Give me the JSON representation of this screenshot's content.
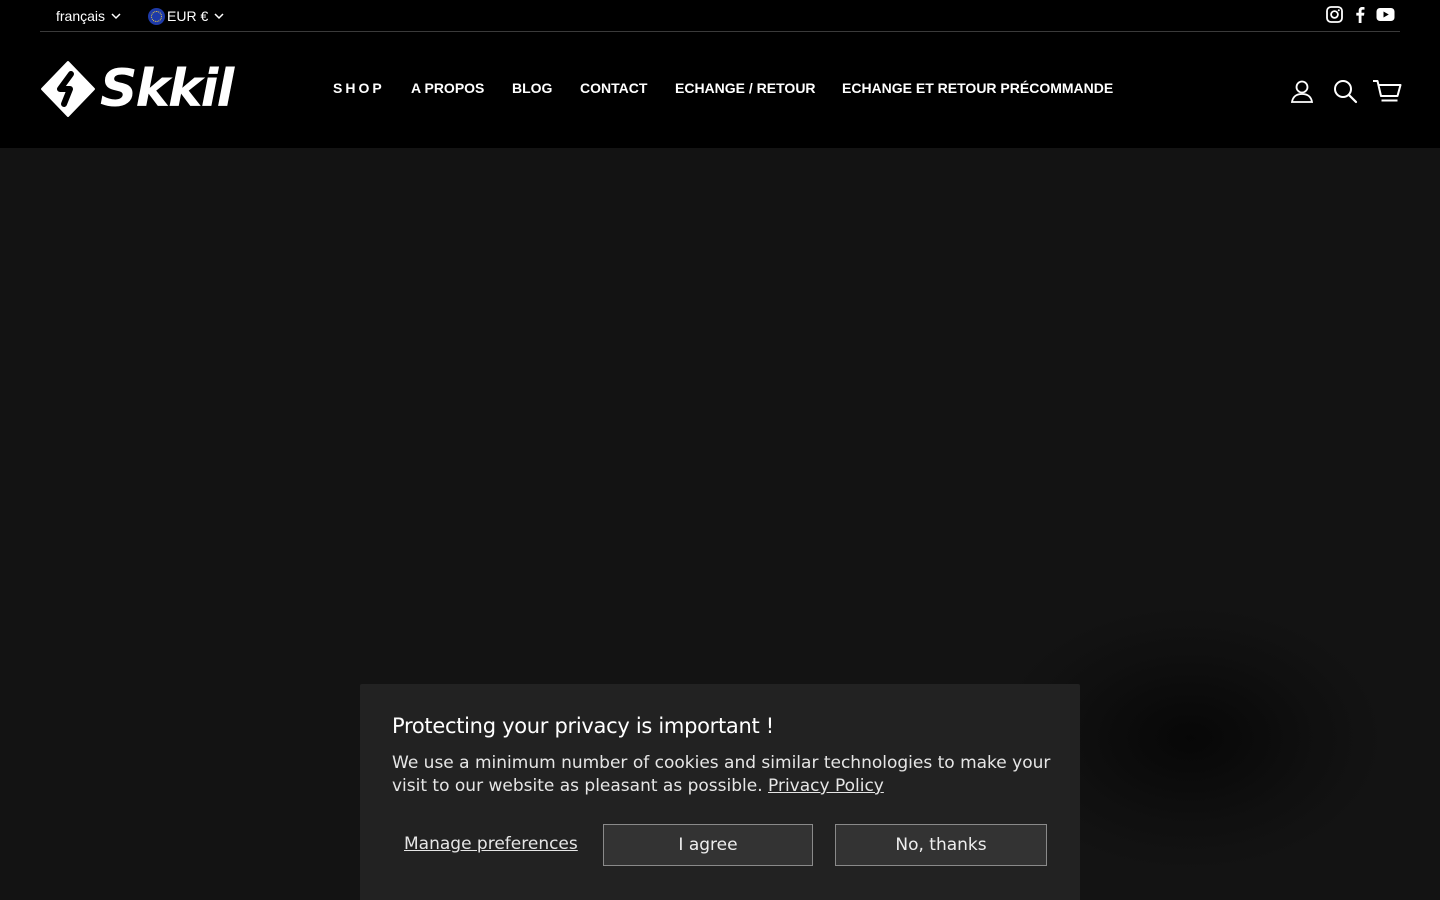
{
  "topbar": {
    "language": "français",
    "currency": "EUR €",
    "social": [
      "instagram-icon",
      "facebook-icon",
      "youtube-icon"
    ]
  },
  "header": {
    "logo_text": "Skkil",
    "nav": [
      {
        "label": "SHOP"
      },
      {
        "label": "A PROPOS"
      },
      {
        "label": "BLOG"
      },
      {
        "label": "CONTACT"
      },
      {
        "label": "ECHANGE / RETOUR"
      },
      {
        "label": "ECHANGE ET RETOUR PRÉCOMMANDE"
      }
    ],
    "icons": [
      "account-icon",
      "search-icon",
      "cart-icon"
    ]
  },
  "cookie_banner": {
    "title": "Protecting your privacy is important !",
    "body": "We use a minimum number of cookies and similar technologies to make your visit to our website as pleasant as possible.",
    "policy_link": "Privacy Policy",
    "manage_label": "Manage preferences",
    "agree_label": "I agree",
    "decline_label": "No, thanks"
  },
  "colors": {
    "header_bg": "#000000",
    "hero_bg": "#131313",
    "banner_bg": "#222222",
    "button_bg": "#333333"
  }
}
